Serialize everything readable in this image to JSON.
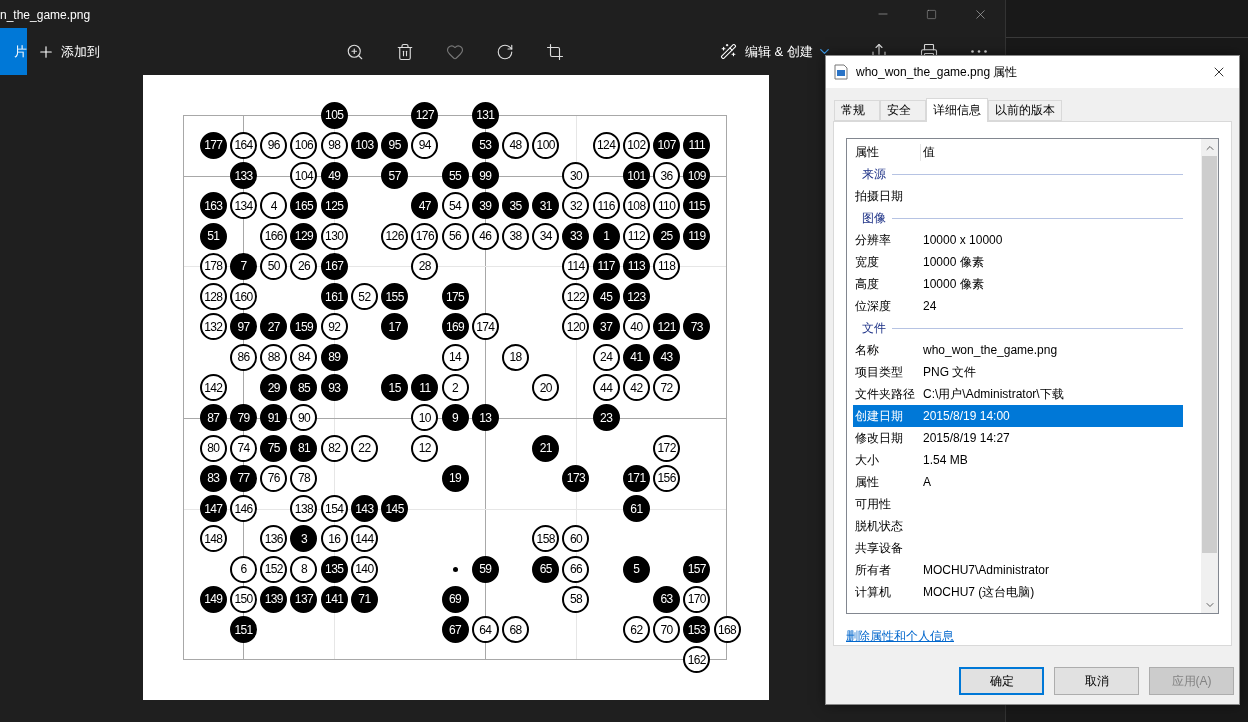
{
  "viewer": {
    "title": "n_the_game.png",
    "nav_button": "片",
    "add_button": "添加到",
    "edit_button": "编辑 & 创建"
  },
  "board": {
    "rows": [
      [
        {
          "kind": "empty"
        },
        {
          "kind": "empty"
        },
        {
          "kind": "empty"
        },
        {
          "kind": "empty"
        },
        {
          "kind": "empty"
        },
        {
          "kind": "black",
          "label": "105"
        },
        {
          "kind": "empty"
        },
        {
          "kind": "empty"
        },
        {
          "kind": "black",
          "label": "127"
        },
        {
          "kind": "empty"
        },
        {
          "kind": "black",
          "label": "131"
        },
        {
          "kind": "empty"
        },
        {
          "kind": "empty"
        },
        {
          "kind": "empty"
        },
        {
          "kind": "empty"
        },
        {
          "kind": "empty"
        },
        {
          "kind": "empty"
        },
        {
          "kind": "empty"
        },
        {
          "kind": "empty"
        }
      ],
      [
        {
          "kind": "empty"
        },
        {
          "kind": "black",
          "label": "177"
        },
        {
          "kind": "white",
          "label": "164"
        },
        {
          "kind": "white",
          "label": "96"
        },
        {
          "kind": "white",
          "label": "106"
        },
        {
          "kind": "white",
          "label": "98"
        },
        {
          "kind": "black",
          "label": "103"
        },
        {
          "kind": "black",
          "label": "95"
        },
        {
          "kind": "white",
          "label": "94"
        },
        {
          "kind": "empty"
        },
        {
          "kind": "black",
          "label": "53"
        },
        {
          "kind": "white",
          "label": "48"
        },
        {
          "kind": "white",
          "label": "100"
        },
        {
          "kind": "empty"
        },
        {
          "kind": "white",
          "label": "124"
        },
        {
          "kind": "white",
          "label": "102"
        },
        {
          "kind": "black",
          "label": "107"
        },
        {
          "kind": "black",
          "label": "111"
        },
        {
          "kind": "empty"
        }
      ],
      [
        {
          "kind": "empty"
        },
        {
          "kind": "empty"
        },
        {
          "kind": "black",
          "label": "133"
        },
        {
          "kind": "empty"
        },
        {
          "kind": "white",
          "label": "104"
        },
        {
          "kind": "black",
          "label": "49"
        },
        {
          "kind": "empty"
        },
        {
          "kind": "black",
          "label": "57"
        },
        {
          "kind": "empty"
        },
        {
          "kind": "black",
          "label": "55"
        },
        {
          "kind": "black",
          "label": "99"
        },
        {
          "kind": "empty"
        },
        {
          "kind": "empty"
        },
        {
          "kind": "white",
          "label": "30"
        },
        {
          "kind": "empty"
        },
        {
          "kind": "black",
          "label": "101"
        },
        {
          "kind": "white",
          "label": "36"
        },
        {
          "kind": "black",
          "label": "109"
        },
        {
          "kind": "empty"
        }
      ],
      [
        {
          "kind": "empty"
        },
        {
          "kind": "black",
          "label": "163"
        },
        {
          "kind": "white",
          "label": "134"
        },
        {
          "kind": "white",
          "label": "4"
        },
        {
          "kind": "black",
          "label": "165"
        },
        {
          "kind": "black",
          "label": "125"
        },
        {
          "kind": "empty"
        },
        {
          "kind": "empty"
        },
        {
          "kind": "black",
          "label": "47"
        },
        {
          "kind": "white",
          "label": "54"
        },
        {
          "kind": "black",
          "label": "39"
        },
        {
          "kind": "black",
          "label": "35"
        },
        {
          "kind": "black",
          "label": "31"
        },
        {
          "kind": "white",
          "label": "32"
        },
        {
          "kind": "white",
          "label": "116"
        },
        {
          "kind": "white",
          "label": "108"
        },
        {
          "kind": "white",
          "label": "110"
        },
        {
          "kind": "black",
          "label": "115"
        },
        {
          "kind": "empty"
        }
      ],
      [
        {
          "kind": "empty"
        },
        {
          "kind": "black",
          "label": "51"
        },
        {
          "kind": "empty"
        },
        {
          "kind": "white",
          "label": "166"
        },
        {
          "kind": "black",
          "label": "129"
        },
        {
          "kind": "white",
          "label": "130"
        },
        {
          "kind": "empty"
        },
        {
          "kind": "white",
          "label": "126"
        },
        {
          "kind": "white",
          "label": "176"
        },
        {
          "kind": "white",
          "label": "56"
        },
        {
          "kind": "white",
          "label": "46"
        },
        {
          "kind": "white",
          "label": "38"
        },
        {
          "kind": "white",
          "label": "34"
        },
        {
          "kind": "black",
          "label": "33"
        },
        {
          "kind": "black",
          "label": "1"
        },
        {
          "kind": "white",
          "label": "112"
        },
        {
          "kind": "black",
          "label": "25"
        },
        {
          "kind": "black",
          "label": "119"
        },
        {
          "kind": "empty"
        }
      ],
      [
        {
          "kind": "empty"
        },
        {
          "kind": "white",
          "label": "178"
        },
        {
          "kind": "black",
          "label": "7"
        },
        {
          "kind": "white",
          "label": "50"
        },
        {
          "kind": "white",
          "label": "26"
        },
        {
          "kind": "black",
          "label": "167"
        },
        {
          "kind": "empty"
        },
        {
          "kind": "empty"
        },
        {
          "kind": "white",
          "label": "28"
        },
        {
          "kind": "empty"
        },
        {
          "kind": "empty"
        },
        {
          "kind": "empty"
        },
        {
          "kind": "empty"
        },
        {
          "kind": "white",
          "label": "114"
        },
        {
          "kind": "black",
          "label": "117"
        },
        {
          "kind": "black",
          "label": "113"
        },
        {
          "kind": "white",
          "label": "118"
        },
        {
          "kind": "empty"
        },
        {
          "kind": "empty"
        }
      ],
      [
        {
          "kind": "empty"
        },
        {
          "kind": "white",
          "label": "128"
        },
        {
          "kind": "white",
          "label": "160"
        },
        {
          "kind": "empty"
        },
        {
          "kind": "empty"
        },
        {
          "kind": "black",
          "label": "161"
        },
        {
          "kind": "white",
          "label": "52"
        },
        {
          "kind": "black",
          "label": "155"
        },
        {
          "kind": "empty"
        },
        {
          "kind": "black",
          "label": "175"
        },
        {
          "kind": "empty"
        },
        {
          "kind": "empty"
        },
        {
          "kind": "empty"
        },
        {
          "kind": "white",
          "label": "122"
        },
        {
          "kind": "black",
          "label": "45"
        },
        {
          "kind": "black",
          "label": "123"
        },
        {
          "kind": "empty"
        },
        {
          "kind": "empty"
        },
        {
          "kind": "empty"
        }
      ],
      [
        {
          "kind": "empty"
        },
        {
          "kind": "white",
          "label": "132"
        },
        {
          "kind": "black",
          "label": "97"
        },
        {
          "kind": "black",
          "label": "27"
        },
        {
          "kind": "black",
          "label": "159"
        },
        {
          "kind": "white",
          "label": "92"
        },
        {
          "kind": "empty"
        },
        {
          "kind": "black",
          "label": "17"
        },
        {
          "kind": "empty"
        },
        {
          "kind": "black",
          "label": "169"
        },
        {
          "kind": "white",
          "label": "174"
        },
        {
          "kind": "empty"
        },
        {
          "kind": "empty"
        },
        {
          "kind": "white",
          "label": "120"
        },
        {
          "kind": "black",
          "label": "37"
        },
        {
          "kind": "white",
          "label": "40"
        },
        {
          "kind": "black",
          "label": "121"
        },
        {
          "kind": "black",
          "label": "73"
        },
        {
          "kind": "empty"
        }
      ],
      [
        {
          "kind": "empty"
        },
        {
          "kind": "empty"
        },
        {
          "kind": "white",
          "label": "86"
        },
        {
          "kind": "white",
          "label": "88"
        },
        {
          "kind": "white",
          "label": "84"
        },
        {
          "kind": "black",
          "label": "89"
        },
        {
          "kind": "empty"
        },
        {
          "kind": "empty"
        },
        {
          "kind": "empty"
        },
        {
          "kind": "white",
          "label": "14"
        },
        {
          "kind": "empty"
        },
        {
          "kind": "white",
          "label": "18"
        },
        {
          "kind": "empty"
        },
        {
          "kind": "empty"
        },
        {
          "kind": "white",
          "label": "24"
        },
        {
          "kind": "black",
          "label": "41"
        },
        {
          "kind": "black",
          "label": "43"
        },
        {
          "kind": "empty"
        },
        {
          "kind": "empty"
        }
      ],
      [
        {
          "kind": "empty"
        },
        {
          "kind": "white",
          "label": "142"
        },
        {
          "kind": "empty"
        },
        {
          "kind": "black",
          "label": "29"
        },
        {
          "kind": "black",
          "label": "85"
        },
        {
          "kind": "black",
          "label": "93"
        },
        {
          "kind": "empty"
        },
        {
          "kind": "black",
          "label": "15"
        },
        {
          "kind": "black",
          "label": "11"
        },
        {
          "kind": "white",
          "label": "2"
        },
        {
          "kind": "empty"
        },
        {
          "kind": "empty"
        },
        {
          "kind": "white",
          "label": "20"
        },
        {
          "kind": "empty"
        },
        {
          "kind": "white",
          "label": "44"
        },
        {
          "kind": "white",
          "label": "42"
        },
        {
          "kind": "white",
          "label": "72"
        },
        {
          "kind": "empty"
        },
        {
          "kind": "empty"
        }
      ],
      [
        {
          "kind": "empty"
        },
        {
          "kind": "black",
          "label": "87"
        },
        {
          "kind": "black",
          "label": "79"
        },
        {
          "kind": "black",
          "label": "91"
        },
        {
          "kind": "white",
          "label": "90"
        },
        {
          "kind": "empty"
        },
        {
          "kind": "empty"
        },
        {
          "kind": "empty"
        },
        {
          "kind": "white",
          "label": "10"
        },
        {
          "kind": "black",
          "label": "9"
        },
        {
          "kind": "black",
          "label": "13"
        },
        {
          "kind": "empty"
        },
        {
          "kind": "empty"
        },
        {
          "kind": "empty"
        },
        {
          "kind": "black",
          "label": "23"
        },
        {
          "kind": "empty"
        },
        {
          "kind": "empty"
        },
        {
          "kind": "empty"
        },
        {
          "kind": "empty"
        }
      ],
      [
        {
          "kind": "empty"
        },
        {
          "kind": "white",
          "label": "80"
        },
        {
          "kind": "white",
          "label": "74"
        },
        {
          "kind": "black",
          "label": "75"
        },
        {
          "kind": "black",
          "label": "81"
        },
        {
          "kind": "white",
          "label": "82"
        },
        {
          "kind": "white",
          "label": "22"
        },
        {
          "kind": "empty"
        },
        {
          "kind": "white",
          "label": "12"
        },
        {
          "kind": "empty"
        },
        {
          "kind": "empty"
        },
        {
          "kind": "empty"
        },
        {
          "kind": "black",
          "label": "21"
        },
        {
          "kind": "empty"
        },
        {
          "kind": "empty"
        },
        {
          "kind": "empty"
        },
        {
          "kind": "white",
          "label": "172"
        },
        {
          "kind": "empty"
        },
        {
          "kind": "empty"
        }
      ],
      [
        {
          "kind": "empty"
        },
        {
          "kind": "black",
          "label": "83"
        },
        {
          "kind": "black",
          "label": "77"
        },
        {
          "kind": "white",
          "label": "76"
        },
        {
          "kind": "white",
          "label": "78"
        },
        {
          "kind": "empty"
        },
        {
          "kind": "empty"
        },
        {
          "kind": "empty"
        },
        {
          "kind": "empty"
        },
        {
          "kind": "black",
          "label": "19"
        },
        {
          "kind": "empty"
        },
        {
          "kind": "empty"
        },
        {
          "kind": "empty"
        },
        {
          "kind": "black",
          "label": "173"
        },
        {
          "kind": "empty"
        },
        {
          "kind": "black",
          "label": "171"
        },
        {
          "kind": "white",
          "label": "156"
        },
        {
          "kind": "empty"
        },
        {
          "kind": "empty"
        }
      ],
      [
        {
          "kind": "empty"
        },
        {
          "kind": "black",
          "label": "147"
        },
        {
          "kind": "white",
          "label": "146"
        },
        {
          "kind": "empty"
        },
        {
          "kind": "white",
          "label": "138"
        },
        {
          "kind": "white",
          "label": "154"
        },
        {
          "kind": "black",
          "label": "143"
        },
        {
          "kind": "black",
          "label": "145"
        },
        {
          "kind": "empty"
        },
        {
          "kind": "empty"
        },
        {
          "kind": "empty"
        },
        {
          "kind": "empty"
        },
        {
          "kind": "empty"
        },
        {
          "kind": "empty"
        },
        {
          "kind": "empty"
        },
        {
          "kind": "black",
          "label": "61"
        },
        {
          "kind": "empty"
        },
        {
          "kind": "empty"
        },
        {
          "kind": "empty"
        }
      ],
      [
        {
          "kind": "empty"
        },
        {
          "kind": "white",
          "label": "148"
        },
        {
          "kind": "empty"
        },
        {
          "kind": "white",
          "label": "136"
        },
        {
          "kind": "black",
          "label": "3"
        },
        {
          "kind": "white",
          "label": "16"
        },
        {
          "kind": "white",
          "label": "144"
        },
        {
          "kind": "empty"
        },
        {
          "kind": "empty"
        },
        {
          "kind": "empty"
        },
        {
          "kind": "empty"
        },
        {
          "kind": "empty"
        },
        {
          "kind": "white",
          "label": "158"
        },
        {
          "kind": "white",
          "label": "60"
        },
        {
          "kind": "empty"
        },
        {
          "kind": "empty"
        },
        {
          "kind": "empty"
        },
        {
          "kind": "empty"
        },
        {
          "kind": "empty"
        }
      ],
      [
        {
          "kind": "empty"
        },
        {
          "kind": "empty"
        },
        {
          "kind": "white",
          "label": "6"
        },
        {
          "kind": "white",
          "label": "152"
        },
        {
          "kind": "white",
          "label": "8"
        },
        {
          "kind": "black",
          "label": "135"
        },
        {
          "kind": "white",
          "label": "140"
        },
        {
          "kind": "empty"
        },
        {
          "kind": "empty"
        },
        {
          "kind": "dot"
        },
        {
          "kind": "black",
          "label": "59"
        },
        {
          "kind": "empty"
        },
        {
          "kind": "black",
          "label": "65"
        },
        {
          "kind": "white",
          "label": "66"
        },
        {
          "kind": "empty"
        },
        {
          "kind": "black",
          "label": "5"
        },
        {
          "kind": "empty"
        },
        {
          "kind": "black",
          "label": "157"
        },
        {
          "kind": "empty"
        }
      ],
      [
        {
          "kind": "empty"
        },
        {
          "kind": "black",
          "label": "149"
        },
        {
          "kind": "white",
          "label": "150"
        },
        {
          "kind": "black",
          "label": "139"
        },
        {
          "kind": "black",
          "label": "137"
        },
        {
          "kind": "black",
          "label": "141"
        },
        {
          "kind": "black",
          "label": "71"
        },
        {
          "kind": "empty"
        },
        {
          "kind": "empty"
        },
        {
          "kind": "black",
          "label": "69"
        },
        {
          "kind": "empty"
        },
        {
          "kind": "empty"
        },
        {
          "kind": "empty"
        },
        {
          "kind": "white",
          "label": "58"
        },
        {
          "kind": "empty"
        },
        {
          "kind": "empty"
        },
        {
          "kind": "black",
          "label": "63"
        },
        {
          "kind": "white",
          "label": "170"
        },
        {
          "kind": "empty"
        }
      ],
      [
        {
          "kind": "empty"
        },
        {
          "kind": "empty"
        },
        {
          "kind": "black",
          "label": "151"
        },
        {
          "kind": "empty"
        },
        {
          "kind": "empty"
        },
        {
          "kind": "empty"
        },
        {
          "kind": "empty"
        },
        {
          "kind": "empty"
        },
        {
          "kind": "empty"
        },
        {
          "kind": "black",
          "label": "67"
        },
        {
          "kind": "white",
          "label": "64"
        },
        {
          "kind": "white",
          "label": "68"
        },
        {
          "kind": "empty"
        },
        {
          "kind": "empty"
        },
        {
          "kind": "empty"
        },
        {
          "kind": "white",
          "label": "62"
        },
        {
          "kind": "white",
          "label": "70"
        },
        {
          "kind": "black",
          "label": "153"
        },
        {
          "kind": "white",
          "label": "168"
        }
      ],
      [
        {
          "kind": "empty"
        },
        {
          "kind": "empty"
        },
        {
          "kind": "empty"
        },
        {
          "kind": "empty"
        },
        {
          "kind": "empty"
        },
        {
          "kind": "empty"
        },
        {
          "kind": "empty"
        },
        {
          "kind": "empty"
        },
        {
          "kind": "empty"
        },
        {
          "kind": "empty"
        },
        {
          "kind": "empty"
        },
        {
          "kind": "empty"
        },
        {
          "kind": "empty"
        },
        {
          "kind": "empty"
        },
        {
          "kind": "empty"
        },
        {
          "kind": "empty"
        },
        {
          "kind": "empty"
        },
        {
          "kind": "white",
          "label": "162"
        },
        {
          "kind": "empty"
        }
      ]
    ]
  },
  "dialog": {
    "title": "who_won_the_game.png 属性",
    "tabs": [
      {
        "label": "常规",
        "selected": false
      },
      {
        "label": "安全",
        "selected": false
      },
      {
        "label": "详细信息",
        "selected": true
      },
      {
        "label": "以前的版本",
        "selected": false
      }
    ],
    "columns": [
      "属性",
      "值"
    ],
    "items": [
      {
        "kind": "section",
        "label": "来源"
      },
      {
        "kind": "property",
        "name": "拍摄日期",
        "selected": false
      },
      {
        "kind": "section",
        "label": "图像"
      },
      {
        "kind": "property",
        "name": "分辨率",
        "value": "10000 x 10000",
        "selected": false
      },
      {
        "kind": "property",
        "name": "宽度",
        "value": "10000 像素",
        "selected": false
      },
      {
        "kind": "property",
        "name": "高度",
        "value": "10000 像素",
        "selected": false
      },
      {
        "kind": "property",
        "name": "位深度",
        "value": "24",
        "selected": false
      },
      {
        "kind": "section",
        "label": "文件"
      },
      {
        "kind": "property",
        "name": "名称",
        "value": "who_won_the_game.png",
        "selected": false
      },
      {
        "kind": "property",
        "name": "项目类型",
        "value": "PNG 文件",
        "selected": false
      },
      {
        "kind": "property",
        "name": "文件夹路径",
        "value": "C:\\用户\\Administrator\\下载",
        "selected": false
      },
      {
        "kind": "property",
        "name": "创建日期",
        "value": "2015/8/19 14:00",
        "selected": true
      },
      {
        "kind": "property",
        "name": "修改日期",
        "value": "2015/8/19 14:27",
        "selected": false
      },
      {
        "kind": "property",
        "name": "大小",
        "value": "1.54 MB",
        "selected": false
      },
      {
        "kind": "property",
        "name": "属性",
        "value": "A",
        "selected": false
      },
      {
        "kind": "property",
        "name": "可用性",
        "selected": false
      },
      {
        "kind": "property",
        "name": "脱机状态",
        "selected": false
      },
      {
        "kind": "property",
        "name": "共享设备",
        "selected": false
      },
      {
        "kind": "property",
        "name": "所有者",
        "value": "MOCHU7\\Administrator",
        "selected": false
      },
      {
        "kind": "property",
        "name": "计算机",
        "value": "MOCHU7 (这台电脑)",
        "selected": false
      }
    ],
    "link": "删除属性和个人信息",
    "buttons": [
      {
        "label": "确定",
        "default": true,
        "disabled": false
      },
      {
        "label": "取消",
        "default": false,
        "disabled": false
      },
      {
        "label": "应用(A)",
        "default": false,
        "disabled": true
      }
    ]
  }
}
